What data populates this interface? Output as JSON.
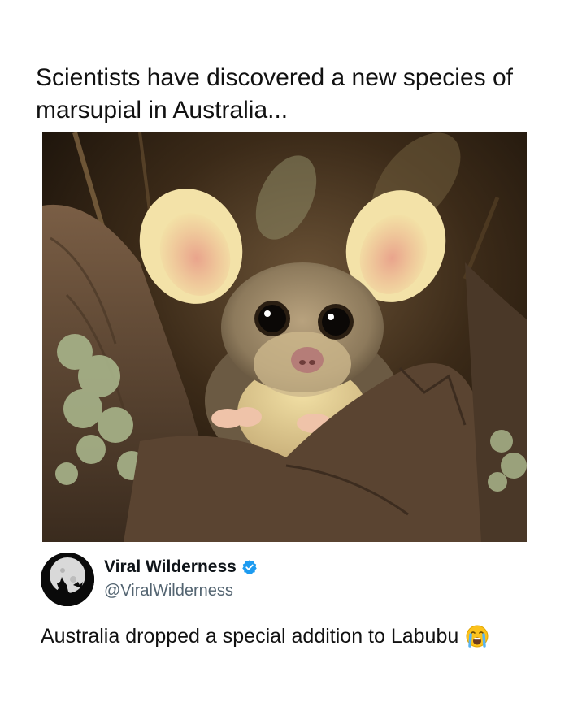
{
  "post": {
    "headline": "Scientists have discovered a new species of marsupial in Australia...",
    "photo_icon": "marsupial-photo"
  },
  "tweet": {
    "author": {
      "display_name": "Viral Wilderness",
      "handle": "@ViralWilderness",
      "verified": true,
      "avatar_icon": "howling-wolf-moon-icon"
    },
    "text": "Australia dropped a special addition to Labubu",
    "emoji_icon": "loudly-crying-face-icon"
  },
  "colors": {
    "verified_blue": "#1d9bf0",
    "handle_gray": "#536471",
    "text_dark": "#0f1419"
  }
}
